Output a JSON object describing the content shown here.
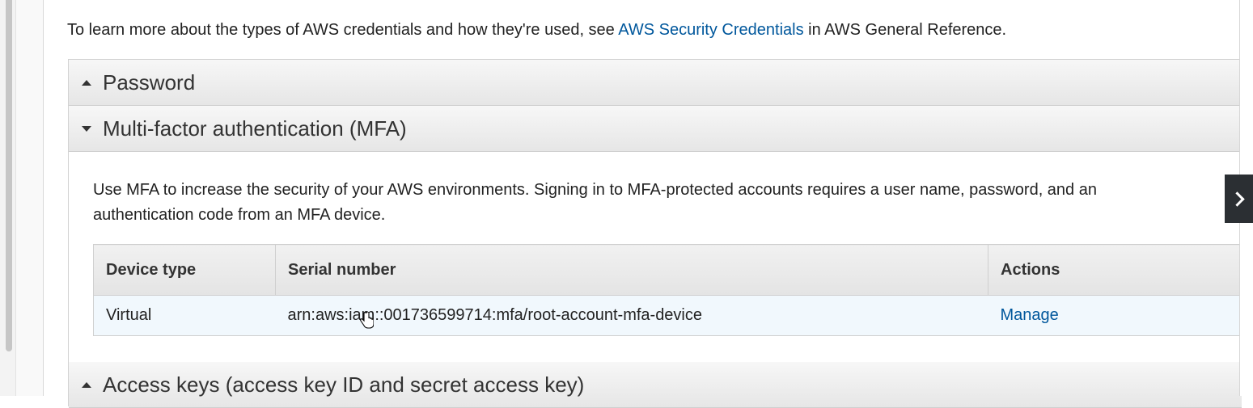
{
  "intro": {
    "prefix": "To learn more about the types of AWS credentials and how they're used, see ",
    "link": "AWS Security Credentials",
    "suffix": " in AWS General Reference."
  },
  "sections": {
    "password": {
      "title": "Password",
      "expanded": false
    },
    "mfa": {
      "title": "Multi-factor authentication (MFA)",
      "expanded": true,
      "description": "Use MFA to increase the security of your AWS environments. Signing in to MFA-protected accounts requires a user name, password, and an authentication code from an MFA device.",
      "table": {
        "headers": [
          "Device type",
          "Serial number",
          "Actions"
        ],
        "rows": [
          {
            "device_type": "Virtual",
            "serial": "arn:aws:iam::001736599714:mfa/root-account-mfa-device",
            "action": "Manage"
          }
        ]
      }
    },
    "access_keys": {
      "title": "Access keys (access key ID and secret access key)",
      "expanded": false
    }
  },
  "icons": {
    "side_toggle": "chevron-right-icon",
    "cursor": "hand-pointer-icon"
  },
  "colors": {
    "link": "#00579c",
    "selected_row": "#f1f8fd",
    "side_toggle_bg": "#2b2f33"
  }
}
